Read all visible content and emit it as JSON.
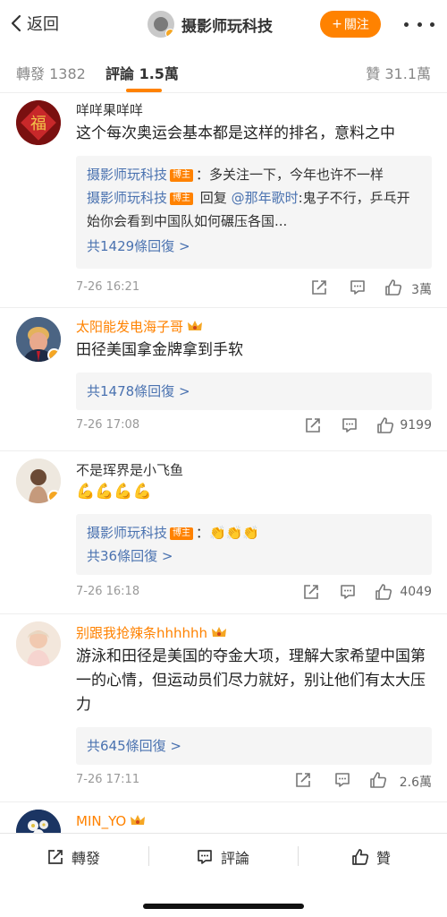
{
  "nav": {
    "back_label": "返回",
    "title": "摄影师玩科技",
    "follow_label": "關注",
    "follow_plus": "+"
  },
  "tabs": {
    "repost": "轉發 1382",
    "comments": "評論 1.5萬",
    "likes": "贊 31.1萬"
  },
  "colors": {
    "accent": "#ff8200",
    "link": "#4a72b0",
    "badge": "#f5a623"
  },
  "comments": [
    {
      "user": "咩咩果咩咩",
      "text": "这个每次奥运会基本都是这样的排名，意料之中",
      "replies": [
        {
          "user": "摄影师玩科技",
          "tag": "博主",
          "text": "：多关注一下，今年也许不一样"
        },
        {
          "user": "摄影师玩科技",
          "tag": "博主",
          "reply_word": " 回复",
          "mention": "@那年歌时",
          "text": ":鬼子不行，乒乓开始你会看到中国队如何碾压各国..."
        }
      ],
      "more_replies": "共1429條回復 >",
      "time": "7-26 16:21",
      "likes": "3萬"
    },
    {
      "user": "太阳能发电海子哥",
      "text": "田径美国拿金牌拿到手软",
      "more_replies": "共1478條回復 >",
      "time": "7-26 17:08",
      "likes": "9199"
    },
    {
      "user": "不是珲界是小飞鱼",
      "text": "💪💪💪💪",
      "replies": [
        {
          "user": "摄影师玩科技",
          "tag": "博主",
          "text": "：👏👏👏"
        }
      ],
      "more_replies": "共36條回復 >",
      "time": "7-26 16:18",
      "likes": "4049"
    },
    {
      "user": "别跟我抢辣条hhhhhh",
      "text": "游泳和田径是美国的夺金大项，理解大家希望中国第一的心情，但运动员们尽力就好，别让他们有太大压力",
      "more_replies": "共645條回復 >",
      "time": "7-26 17:11",
      "likes": "2.6萬"
    },
    {
      "user": "MIN_YO"
    }
  ],
  "bottom": {
    "repost": "轉發",
    "comment": "評論",
    "like": "贊"
  }
}
